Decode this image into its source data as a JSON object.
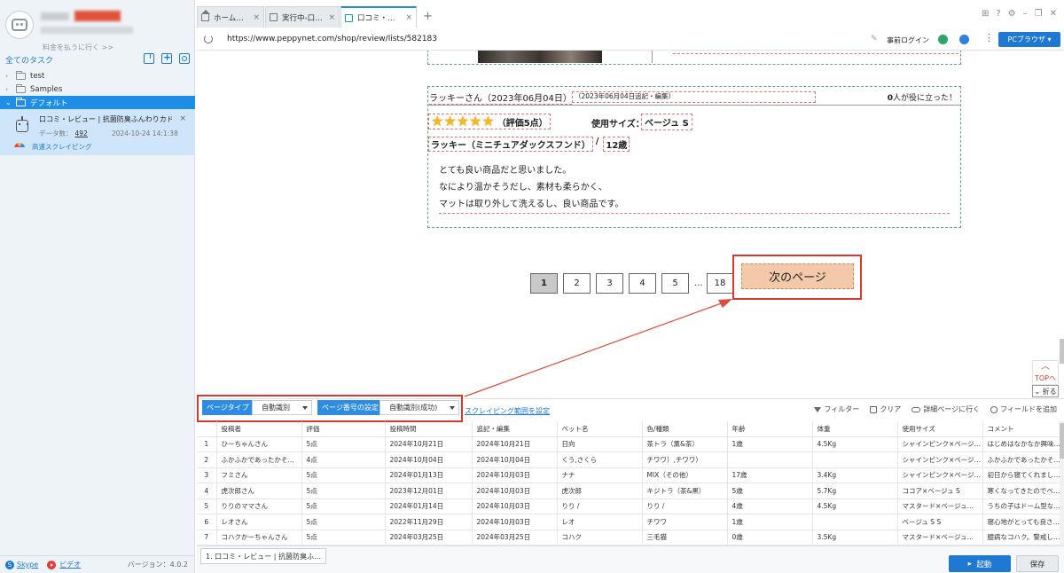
{
  "sidebar": {
    "upgrade_link": "料金を払うに行く >>",
    "tasks_title": "全てのタスク",
    "tree": [
      {
        "label": "test",
        "expanded": false
      },
      {
        "label": "Samples",
        "expanded": false
      },
      {
        "label": "デフォルト",
        "expanded": true
      }
    ],
    "task": {
      "title": "口コミ・レビュー | 抗菌防臭ふんわりカド…",
      "count_label": "データ数：",
      "count": "492",
      "timestamp": "2024-10-24 14:1:38",
      "mode": "高速スクレイピング"
    },
    "footer": {
      "skype": "Skype",
      "video": "ビデオ",
      "version": "バージョン：4.0.2"
    }
  },
  "browser": {
    "tabs": [
      {
        "label": "ホーム…"
      },
      {
        "label": "実行中-口…"
      },
      {
        "label": "口コミ・…"
      }
    ],
    "url": "https://www.peppynet.com/shop/review/lists/582183",
    "login": "事前ログイン",
    "pc_browser": "PCブラウザ"
  },
  "review": {
    "reviewer": "ラッキーさん（2023年06月04日）",
    "note": "（2023年06月04日追記・編集）",
    "helpful_count": "0",
    "helpful_text": "人が役に立った！",
    "rating": 5,
    "rating_text": "（評価5点）",
    "size_label": "使用サイズ：",
    "size_value": "ベージュ S",
    "breed": "ラッキー（ミニチュアダックスフンド）",
    "separator": "/",
    "age": "12歳",
    "comment": [
      "とても良い商品だと思いました。",
      "なにより温かそうだし、素材も柔らかく、",
      "マットは取り外して洗えるし、良い商品です。"
    ]
  },
  "pagination": {
    "pages": [
      "1",
      "2",
      "3",
      "4",
      "5"
    ],
    "ellipsis": "...",
    "last": "18",
    "next": "次のページ",
    "current": "1"
  },
  "overlay": {
    "top": "TOPへ",
    "fold": "折る"
  },
  "config": {
    "page_type_label": "ページタイプ",
    "page_type_value": "自動識別",
    "page_number_label": "ページ番号の設定",
    "page_number_value": "自動識別(成功)",
    "scope_link": "スクレイピング範囲を設定",
    "tools": {
      "filter": "フィルター",
      "clear": "クリア",
      "detail": "詳細ページに行く",
      "add_field": "フィールドを追加"
    }
  },
  "table": {
    "columns": [
      "",
      "投稿者",
      "評価",
      "投稿時間",
      "追記・編集",
      "ペット名",
      "色/種類",
      "年齢",
      "体重",
      "使用サイズ",
      "コメント"
    ],
    "rows": [
      [
        "1",
        "ひーちゃんさん",
        "5点",
        "2024年10月21日",
        "2024年10月21日",
        "日向",
        "茶トラ（薫&茶）",
        "1歳",
        "4.5Kg",
        "シャインピンク×ベージ…",
        "はじめはなかなか興味…"
      ],
      [
        "2",
        "ふかふかであったかそ…",
        "4点",
        "2024年10月04日",
        "2024年10月04日",
        "くう,さくら",
        "チワワ）,チワワ）",
        "",
        "",
        "シャインピンク×ベージ…",
        "ふかふかであったかそ…"
      ],
      [
        "3",
        "フミさん",
        "5点",
        "2024年01月13日",
        "2024年10月03日",
        "ナナ",
        "MIX（その他）",
        "17歳",
        "3.4Kg",
        "シャインピンク×ベージ…",
        "初日から寝てくれまし…"
      ],
      [
        "4",
        "虎次郎さん",
        "5点",
        "2023年12月01日",
        "2024年10月03日",
        "虎次郎",
        "キジトラ（茶&黒）",
        "5歳",
        "5.7Kg",
        "ココア×ベージュ S",
        "寒くなってきたのでベ…"
      ],
      [
        "5",
        "りりのママさん",
        "5点",
        "2024年01月14日",
        "2024年10月03日",
        "りり /",
        "りり /",
        "4歳",
        "4.5Kg",
        "マスタード×ベージュ…",
        "うちの子はドーム型な…"
      ],
      [
        "6",
        "レオさん",
        "5点",
        "2022年11月29日",
        "2024年10月03日",
        "レオ",
        "チワワ",
        "1歳",
        "",
        "ベージュ S S",
        "寝心地がとっても良さ…"
      ],
      [
        "7",
        "コハクかーちゃんさん",
        "5点",
        "2024年03月25日",
        "2024年03月25日",
        "コハク",
        "三毛猫",
        "0歳",
        "3.5Kg",
        "マスタード×ベージュ…",
        "臆病なコハク。警戒し…"
      ]
    ]
  },
  "actionbar": {
    "task_tab": "1. 口コミ・レビュー | 抗菌防臭ふ…",
    "start": "起動",
    "save": "保存"
  },
  "colors": {
    "accent": "#1f78d1",
    "highlight": "#d9392d",
    "next_button": "#f3c9a9",
    "star": "#f6b81e"
  }
}
